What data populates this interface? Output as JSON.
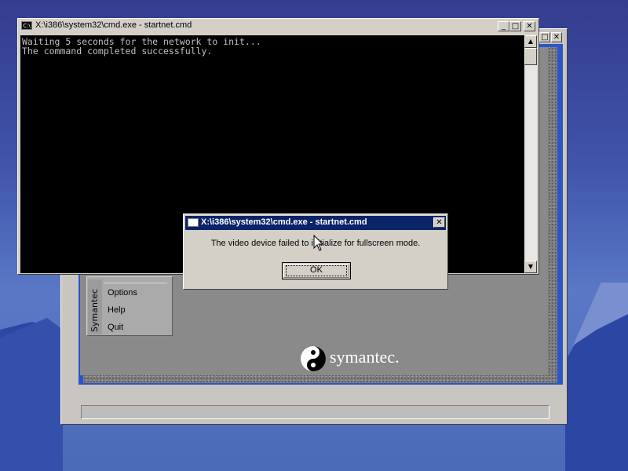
{
  "desktop": {
    "background": "#3f54aa"
  },
  "back_window": {
    "menu": {
      "brand": "Symantec",
      "items": [
        {
          "label": "Options"
        },
        {
          "label": "Help"
        },
        {
          "label": "Quit"
        }
      ]
    },
    "logo_text": "symantec.",
    "close_glyph": "✕",
    "max_glyph": "□"
  },
  "cmd_window": {
    "title": "X:\\i386\\system32\\cmd.exe - startnet.cmd",
    "icon_text": "C:\\",
    "controls": {
      "minimize": "_",
      "maximize": "□",
      "close": "✕"
    },
    "console_lines": [
      "Waiting 5 seconds for the network to init...",
      "The command completed successfully."
    ],
    "scroll_up": "▲",
    "scroll_down": "▼"
  },
  "dialog": {
    "title": "X:\\i386\\system32\\cmd.exe - startnet.cmd",
    "message": "The video device failed to initialize for fullscreen mode.",
    "close": "✕",
    "ok_label": "OK"
  }
}
